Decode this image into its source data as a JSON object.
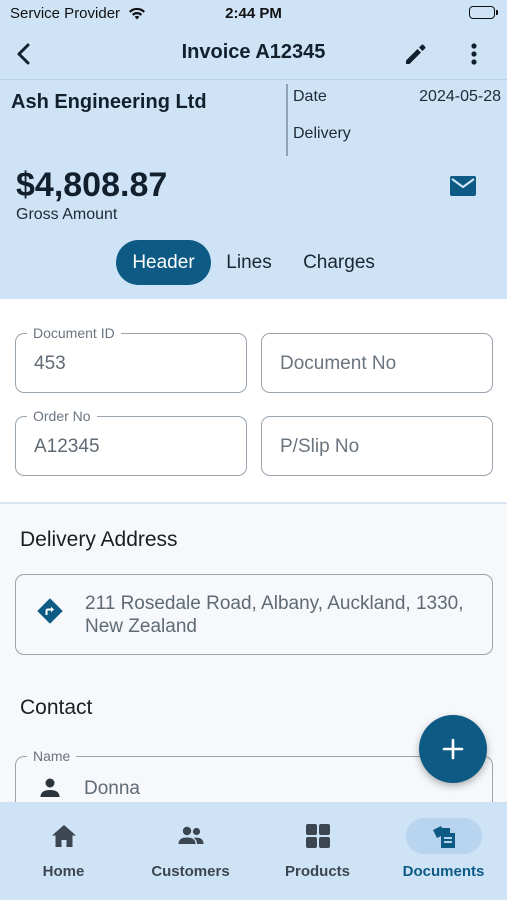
{
  "status_bar": {
    "carrier": "Service Provider",
    "time": "2:44 PM"
  },
  "app_bar": {
    "title": "Invoice A12345",
    "back_icon": "chevron-left-icon",
    "edit_icon": "pencil-icon",
    "more_icon": "more-vertical-icon"
  },
  "summary": {
    "company": "Ash Engineering Ltd",
    "date_label": "Date",
    "date_value": "2024-05-28",
    "delivery_label": "Delivery",
    "amount": "$4,808.87",
    "amount_label": "Gross Amount",
    "mail_icon": "mail-icon"
  },
  "tabs": [
    {
      "label": "Header",
      "active": true
    },
    {
      "label": "Lines",
      "active": false
    },
    {
      "label": "Charges",
      "active": false
    }
  ],
  "header_fields": {
    "document_id": {
      "label": "Document ID",
      "value": "453"
    },
    "document_no": {
      "placeholder": "Document No"
    },
    "order_no": {
      "label": "Order No",
      "value": "A12345"
    },
    "pslip_no": {
      "placeholder": "P/Slip No"
    }
  },
  "delivery_address": {
    "title": "Delivery Address",
    "value": "211 Rosedale Road, Albany, Auckland, 1330, New Zealand",
    "icon": "directions-icon"
  },
  "contact": {
    "title": "Contact",
    "name_label": "Name",
    "name_value": "Donna",
    "icon": "person-icon"
  },
  "fab": {
    "icon": "plus-icon"
  },
  "bottom_nav": [
    {
      "label": "Home",
      "icon": "home-icon",
      "active": false
    },
    {
      "label": "Customers",
      "icon": "people-icon",
      "active": false
    },
    {
      "label": "Products",
      "icon": "grid-icon",
      "active": false
    },
    {
      "label": "Documents",
      "icon": "documents-icon",
      "active": true
    }
  ],
  "colors": {
    "header_bg": "#cfe3f7",
    "accent": "#0d5b85",
    "page_bg": "#f6f8fb"
  }
}
